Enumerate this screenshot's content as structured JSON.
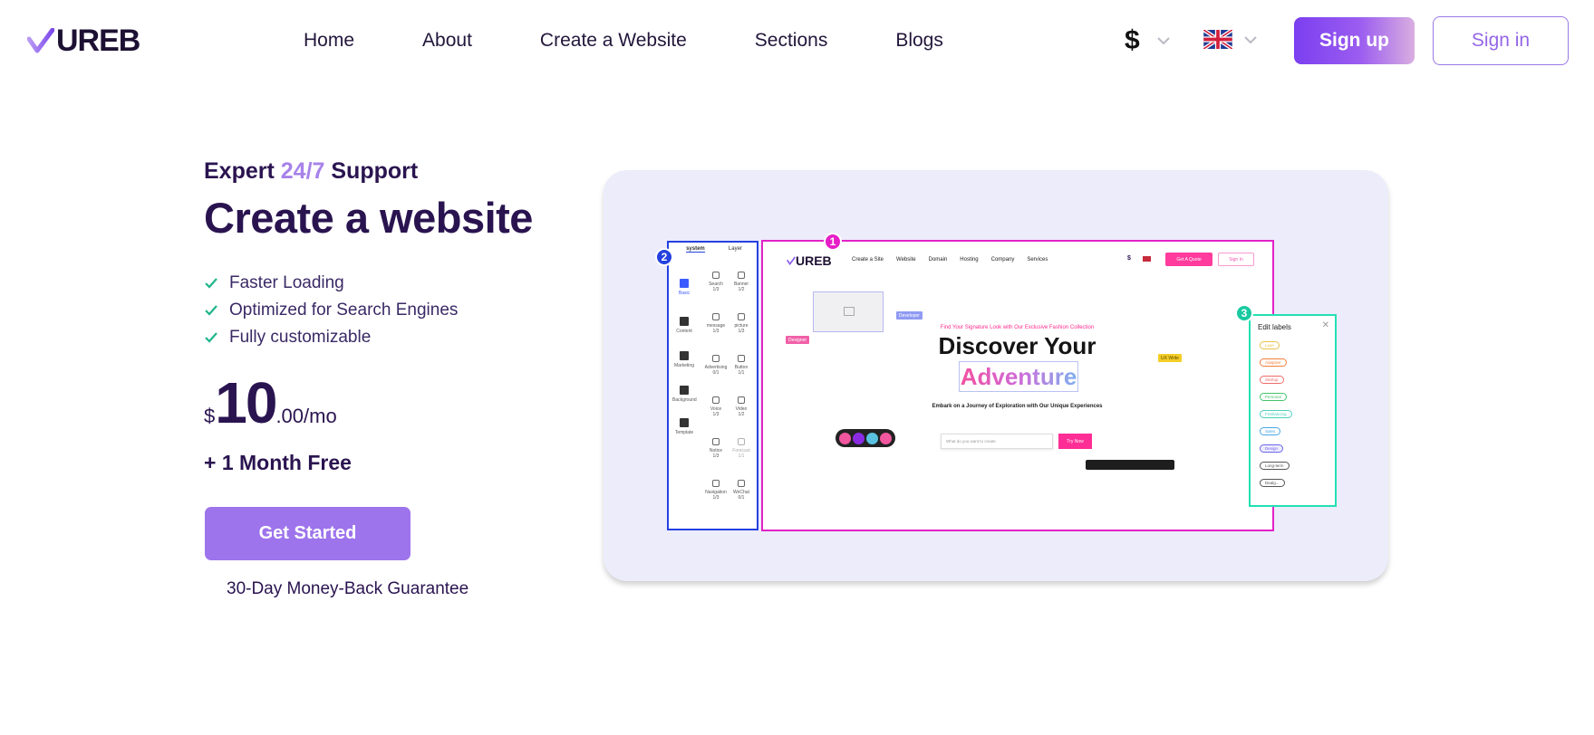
{
  "brand": {
    "name": "UREB"
  },
  "nav": {
    "links": [
      {
        "label": "Home"
      },
      {
        "label": "About"
      },
      {
        "label": "Create a Website"
      },
      {
        "label": "Sections"
      },
      {
        "label": "Blogs"
      }
    ],
    "currency": "$",
    "language_flag": "uk-flag-icon",
    "signup_label": "Sign up",
    "signin_label": "Sign in"
  },
  "hero": {
    "eyebrow_pre": "Expert ",
    "eyebrow_accent": "24/7",
    "eyebrow_post": " Support",
    "title": "Create a website",
    "features": [
      {
        "label": "Faster Loading"
      },
      {
        "label": "Optimized for Search Engines"
      },
      {
        "label": "Fully customizable"
      }
    ],
    "price": {
      "currency": "$",
      "amount": "10",
      "suffix": ".00/mo"
    },
    "bonus": "+ 1 Month Free",
    "cta_label": "Get Started",
    "guarantee": "30-Day Money-Back Guarantee"
  },
  "illustration": {
    "badges": [
      "1",
      "2",
      "3"
    ],
    "left_panel": {
      "tabs": [
        "system",
        "Layer"
      ],
      "categories": [
        "Basic",
        "Content",
        "Marketing",
        "Background",
        "Template"
      ],
      "items": [
        {
          "label": "Search",
          "count": "1/3"
        },
        {
          "label": "Banner",
          "count": "1/2"
        },
        {
          "label": "message",
          "count": "1/3"
        },
        {
          "label": "picture",
          "count": "1/3"
        },
        {
          "label": "Advertising",
          "count": "0/1"
        },
        {
          "label": "Button",
          "count": "1/1"
        },
        {
          "label": "Voice",
          "count": "1/3"
        },
        {
          "label": "Video",
          "count": "1/2"
        },
        {
          "label": "Notice",
          "count": "1/3"
        },
        {
          "label": "Forecast",
          "count": "1/1"
        },
        {
          "label": "Navigation",
          "count": "1/3"
        },
        {
          "label": "WeChat",
          "count": "0/1"
        }
      ]
    },
    "mock_site": {
      "logo": "UREB",
      "nav": [
        "Create a Site",
        "Website",
        "Domain",
        "Hosting",
        "Company",
        "Services"
      ],
      "currency": "$",
      "quote_label": "Get A Quote",
      "signin_label": "Sign In",
      "tags": [
        "Designer",
        "Developer",
        "UX Write"
      ],
      "kicker": "Find Your Signature Look with Our Exclusive Fashion Collection",
      "headline": "Discover Your",
      "headline_accent": "Adventure",
      "subline": "Embark on a Journey of Exploration with Our Unique Experiences",
      "search_placeholder": "What do you want to create",
      "try_label": "Try Now",
      "swatch_colors": [
        "#f0579e",
        "#8a2be2",
        "#58c2e0",
        "#f0579e"
      ]
    },
    "right_panel": {
      "title": "Edit labels",
      "chips": [
        {
          "label": "Luxe",
          "color": "#e8c24a"
        },
        {
          "label": "Adaptive",
          "color": "#f07f3c"
        },
        {
          "label": "Startup",
          "color": "#f06a6a"
        },
        {
          "label": "Personal",
          "color": "#45c56b"
        },
        {
          "label": "Freelancing",
          "color": "#4ed0c0"
        },
        {
          "label": "Sales",
          "color": "#48a8e8"
        },
        {
          "label": "Design",
          "color": "#6a64e6"
        },
        {
          "label": "Long-term",
          "color": "#555555"
        },
        {
          "label": "Dealg...",
          "color": "#555555"
        }
      ]
    }
  },
  "colors": {
    "primary": "#9e74ec",
    "heading": "#2a1450",
    "accent": "#a782ea",
    "showcase_bg": "#ececfb"
  }
}
